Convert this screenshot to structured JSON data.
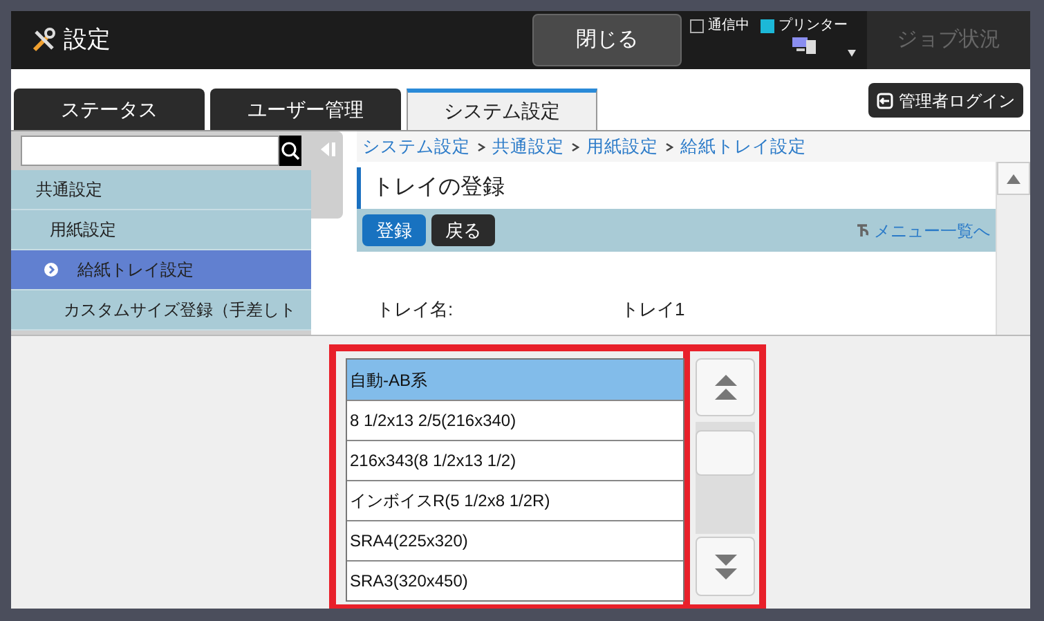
{
  "header": {
    "title": "設定",
    "close_button": "閉じる",
    "indicators": [
      {
        "label": "通信中",
        "on": false
      },
      {
        "label": "プリンター",
        "on": true
      }
    ],
    "job_status_button": {
      "label": "ジョブ状況",
      "disabled": true
    }
  },
  "tabs": [
    {
      "label": "ステータス",
      "selected": false
    },
    {
      "label": "ユーザー管理",
      "selected": false
    },
    {
      "label": "システム設定",
      "selected": true
    }
  ],
  "admin_login_button": "管理者ログイン",
  "sidebar": {
    "items": [
      {
        "label": "共通設定",
        "selected": false,
        "children": [
          {
            "label": "用紙設定",
            "selected": false,
            "children": [
              {
                "label": "給紙トレイ設定",
                "selected": true
              },
              {
                "label": "カスタムサイズ登録（手差しト",
                "selected": false
              }
            ]
          }
        ]
      }
    ]
  },
  "breadcrumb": [
    "システム設定",
    "共通設定",
    "用紙設定",
    "給紙トレイ設定"
  ],
  "page_title": "トレイの登録",
  "toolbar": {
    "buttons": [
      {
        "label": "登録",
        "kind": "primary"
      },
      {
        "label": "戻る",
        "kind": "secondary"
      }
    ],
    "menu_link": "メニュー一覧へ"
  },
  "form": [
    {
      "label": "トレイ名:",
      "value": "トレイ1"
    }
  ],
  "dropdown_list": {
    "items": [
      {
        "label": "自動-AB系",
        "selected": true
      },
      {
        "label": "8 1/2x13 2/5(216x340)",
        "selected": false
      },
      {
        "label": "216x343(8 1/2x13 1/2)",
        "selected": false
      },
      {
        "label": "インボイスR(5 1/2x8 1/2R)",
        "selected": false
      },
      {
        "label": "SRA4(225x320)",
        "selected": false
      },
      {
        "label": "SRA3(320x450)",
        "selected": false
      }
    ]
  }
}
